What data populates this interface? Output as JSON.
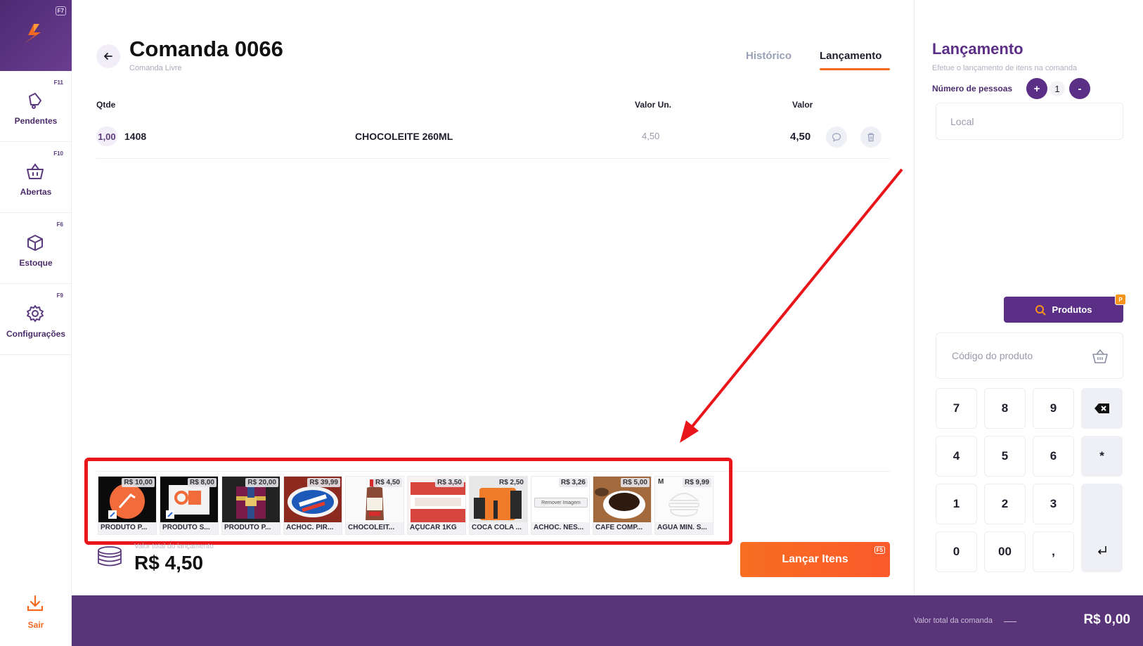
{
  "sidebar": {
    "logo_key": "F7",
    "items": [
      {
        "label": "Pendentes",
        "key": "F11"
      },
      {
        "label": "Abertas",
        "key": "F10"
      },
      {
        "label": "Estoque",
        "key": "F6"
      },
      {
        "label": "Configurações",
        "key": "F9"
      }
    ],
    "exit_label": "Sair"
  },
  "header": {
    "title": "Comanda 0066",
    "subtitle": "Comanda Livre",
    "tabs": [
      {
        "label": "Histórico"
      },
      {
        "label": "Lançamento"
      }
    ]
  },
  "table": {
    "columns": {
      "qty": "Qtde",
      "unit": "Valor Un.",
      "value": "Valor"
    },
    "rows": [
      {
        "qty": "1,00",
        "code": "1408",
        "name": "CHOCOLEITE 260ML",
        "unit": "4,50",
        "value": "4,50"
      }
    ]
  },
  "products": [
    {
      "price": "R$ 10,00",
      "name": "PRODUTO P..."
    },
    {
      "price": "R$ 8,00",
      "name": "PRODUTO S..."
    },
    {
      "price": "R$ 20,00",
      "name": "PRODUTO P..."
    },
    {
      "price": "R$ 39,99",
      "name": "ACHOC. PIR..."
    },
    {
      "price": "R$ 4,50",
      "name": "CHOCOLEIT..."
    },
    {
      "price": "R$ 3,50",
      "name": "AÇUCAR 1KG"
    },
    {
      "price": "R$ 2,50",
      "name": "COCA COLA ..."
    },
    {
      "price": "R$ 3,26",
      "name": "ACHOC. NES...",
      "pic_text": "Remover Imagem"
    },
    {
      "price": "R$ 5,00",
      "name": "CAFE COMP..."
    },
    {
      "price": "R$ 9,99",
      "name": "AGUA MIN. S...",
      "tag": "M"
    }
  ],
  "footer": {
    "total_label": "Valor total do lançamento",
    "total_value": "R$ 4,50",
    "launch_label": "Lançar Itens",
    "launch_key": "F5"
  },
  "right_panel": {
    "title": "Lançamento",
    "subtitle": "Efetue o lançamento de itens na comanda",
    "people_label": "Número de pessoas",
    "people_count": "1",
    "plus": "+",
    "minus": "-",
    "local_placeholder": "Local",
    "products_button": "Produtos",
    "products_key": "P",
    "code_placeholder": "Código do produto",
    "keypad": [
      "7",
      "8",
      "9",
      "4",
      "5",
      "6",
      "*",
      "1",
      "2",
      "3",
      "0",
      "00",
      ","
    ]
  },
  "bottom_bar": {
    "label": "Valor total da comanda",
    "value": "R$ 0,00"
  },
  "colors": {
    "brand_purple": "#5b2f86",
    "accent_orange": "#f26a21",
    "annotation_red": "#e8161a"
  }
}
